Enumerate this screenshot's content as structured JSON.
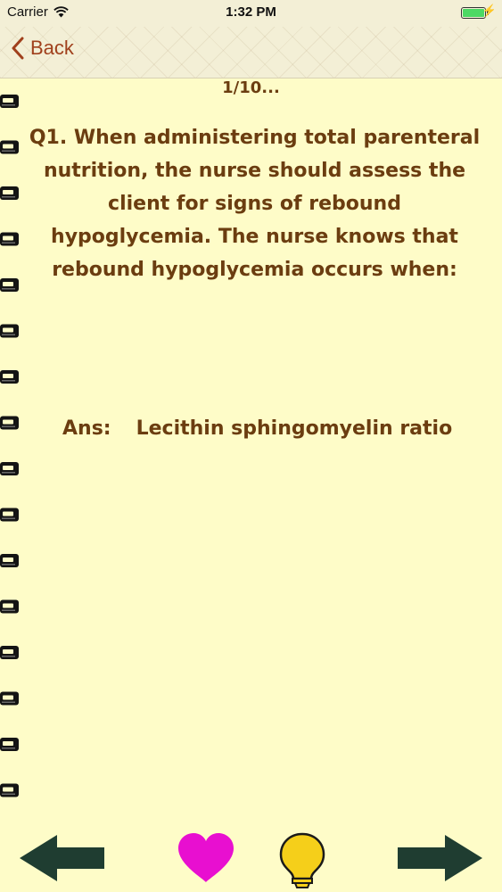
{
  "status_bar": {
    "carrier": "Carrier",
    "time": "1:32 PM"
  },
  "nav": {
    "back_label": "Back"
  },
  "card": {
    "counter": "1/10...",
    "question": "Q1. When administering total parenteral nutrition, the nurse should assess the client for signs of rebound hypoglycemia. The nurse knows that rebound hypoglycemia occurs when:",
    "answer_label": "Ans:",
    "answer_text": "Lecithin sphingomyelin ratio"
  },
  "colors": {
    "page_background": "#fefcc8",
    "text_brown": "#6b3d10",
    "back_red": "#a0401c",
    "arrow_green": "#1f3d31",
    "heart_magenta": "#e80fd0",
    "bulb_yellow": "#f5cf1a",
    "battery_green": "#4cd964"
  },
  "icons": {
    "wifi": "wifi-icon",
    "battery": "battery-icon",
    "charging": "charging-bolt-icon",
    "back": "chevron-left-icon",
    "spiral": "spiral-binding-icon",
    "previous": "arrow-left-icon",
    "favorite": "heart-icon",
    "hint": "lightbulb-icon",
    "next": "arrow-right-icon"
  }
}
